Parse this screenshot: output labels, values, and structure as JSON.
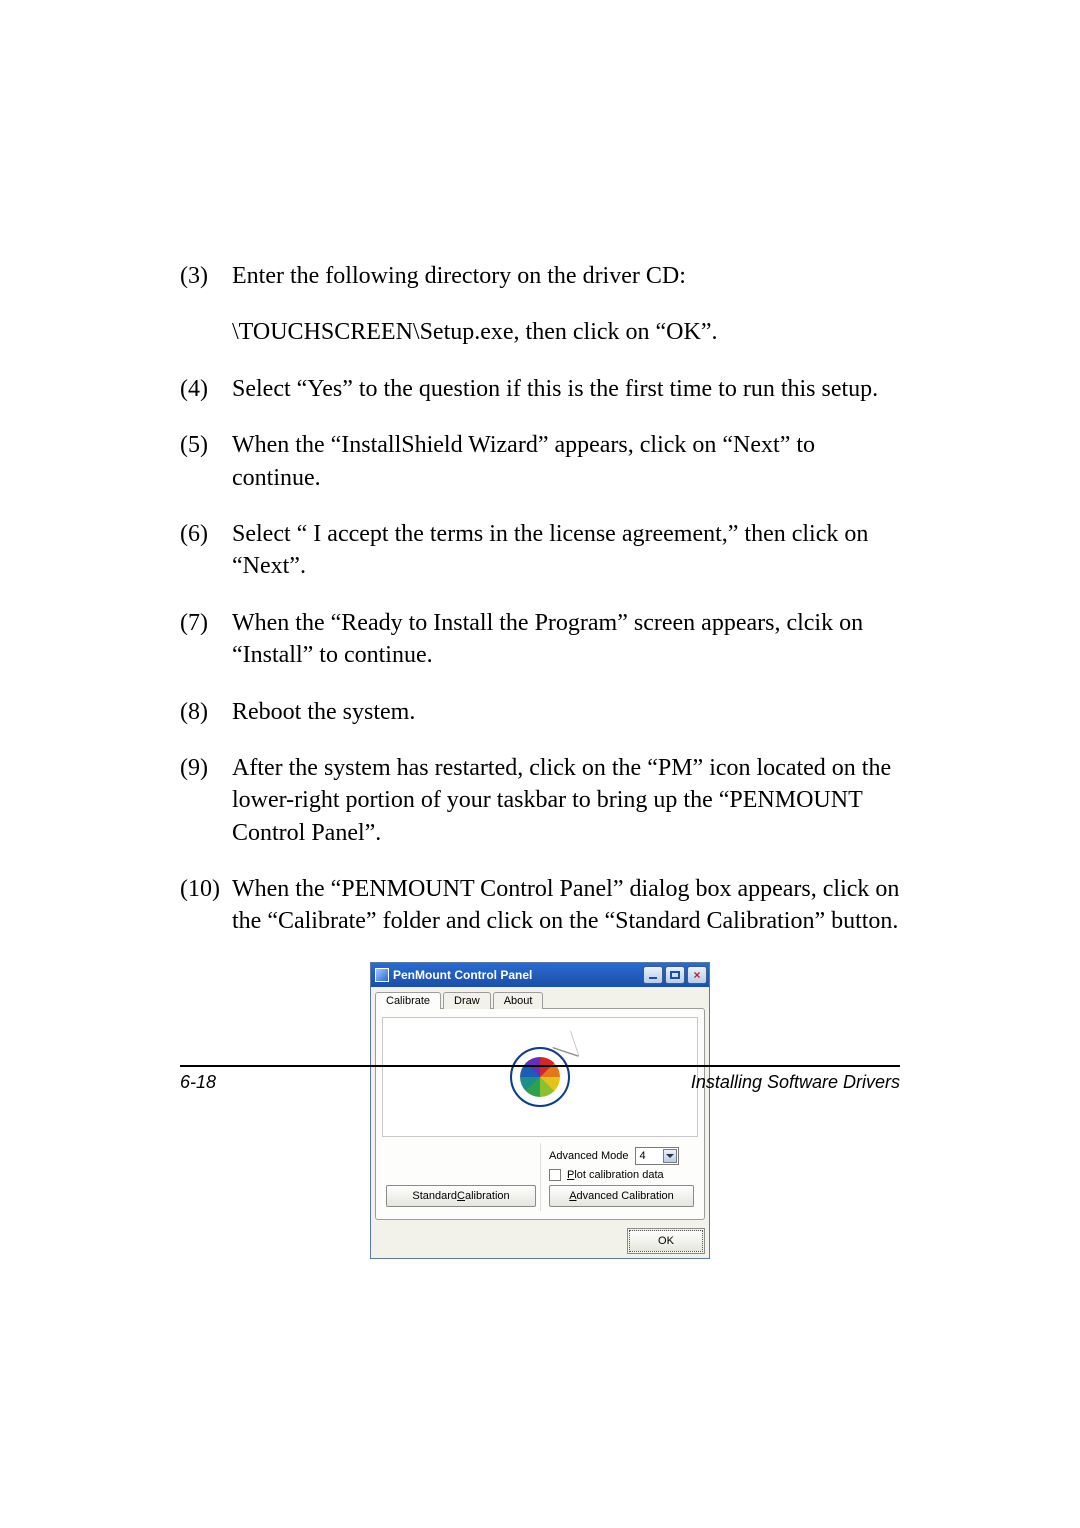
{
  "steps": {
    "s3": {
      "num": "(3)",
      "text": "Enter the following directory on the driver CD:",
      "sub": "\\TOUCHSCREEN\\Setup.exe, then click on “OK”."
    },
    "s4": {
      "num": "(4)",
      "text": "Select “Yes” to the question if this is the first time to run this setup."
    },
    "s5": {
      "num": "(5)",
      "text": "When the “InstallShield Wizard” appears, click on “Next” to continue."
    },
    "s6": {
      "num": "(6)",
      "text": "Select “ I accept the terms in the license agreement,” then click on “Next”."
    },
    "s7": {
      "num": "(7)",
      "text": "When the “Ready to Install the Program” screen appears, clcik on “Install” to continue."
    },
    "s8": {
      "num": "(8)",
      "text": "Reboot the system."
    },
    "s9": {
      "num": "(9)",
      "text": "After the system has restarted, click on the “PM” icon located on the lower-right portion of your taskbar to bring up the “PENMOUNT Control Panel”."
    },
    "s10": {
      "num": "(10)",
      "text": "When the “PENMOUNT Control Panel” dialog box appears, click on the “Calibrate” folder and click on the “Standard Calibration” button."
    }
  },
  "panel": {
    "title": "PenMount Control Panel",
    "tabs": {
      "calibrate": "Calibrate",
      "draw": "Draw",
      "about": "About"
    },
    "adv_mode_label": "Advanced Mode",
    "adv_mode_value": "4",
    "plot_label": "Plot calibration data",
    "std_btn_pre": "Standard ",
    "std_btn_u": "C",
    "std_btn_post": "alibration",
    "adv_btn_u": "A",
    "adv_btn_post": "dvanced Calibration",
    "plot_u": "P",
    "plot_post": "lot calibration data",
    "ok": "OK"
  },
  "footer": {
    "pagenum": "6-18",
    "section": "Installing Software Drivers"
  }
}
